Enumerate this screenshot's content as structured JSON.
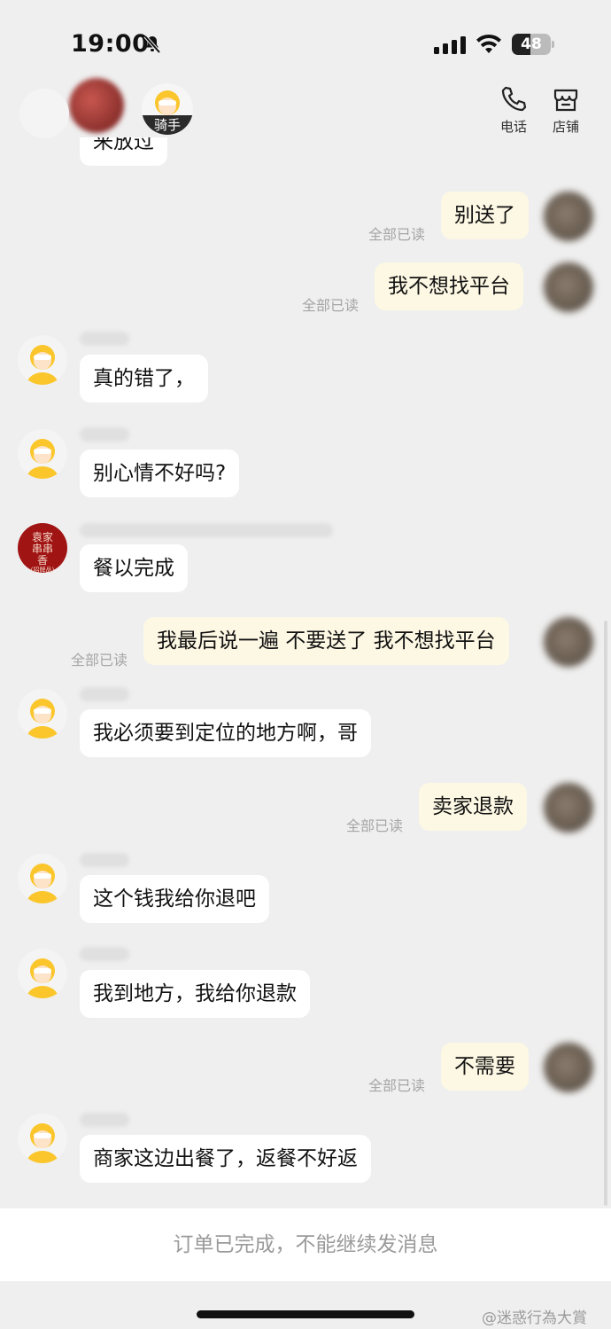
{
  "status_bar": {
    "time": "19:00",
    "battery": "48",
    "battery_level": 0.48
  },
  "header": {
    "rider_tag": "骑手",
    "phone_label": "电话",
    "store_label": "店铺"
  },
  "messages": {
    "m0": "来放过",
    "m1": "别送了",
    "m2": "我不想找平台",
    "m3": "真的错了，",
    "m4": "别心情不好吗?",
    "m5": "餐以完成",
    "m6": "我最后说一遍 不要送了 我不想找平台",
    "m7": "我必须要到定位的地方啊，哥",
    "m8": "卖家退款",
    "m9": "这个钱我给你退吧",
    "m10": "我到地方，我给你退款",
    "m11": "不需要",
    "m12": "商家这边出餐了，返餐不好返"
  },
  "read_receipt": "全部已读",
  "shop_avatar_text": "袁家串串香",
  "shop_avatar_sub": "(招牌品)",
  "footer": {
    "notice": "订单已完成，不能继续发消息",
    "watermark": "@迷惑行為大賞"
  }
}
